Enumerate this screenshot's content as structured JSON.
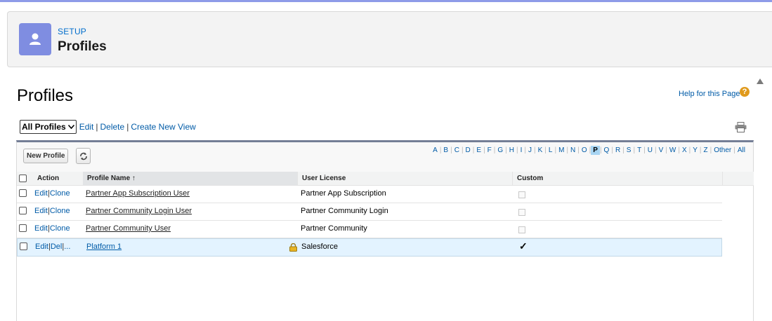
{
  "header": {
    "section_label": "SETUP",
    "title": "Profiles",
    "icon": "user-icon"
  },
  "page": {
    "title": "Profiles",
    "help_link": "Help for this Page",
    "help_icon": "question-icon"
  },
  "view_controls": {
    "selected_view": "All Profiles",
    "edit": "Edit",
    "delete": "Delete",
    "create_new_view": "Create New View",
    "sep": "|"
  },
  "list": {
    "new_profile_button": "New Profile",
    "alphabet": [
      "A",
      "B",
      "C",
      "D",
      "E",
      "F",
      "G",
      "H",
      "I",
      "J",
      "K",
      "L",
      "M",
      "N",
      "O",
      "P",
      "Q",
      "R",
      "S",
      "T",
      "U",
      "V",
      "W",
      "X",
      "Y",
      "Z",
      "Other",
      "All"
    ],
    "active_letter": "P",
    "columns": {
      "action": "Action",
      "profile_name": "Profile Name",
      "sort_indicator": "↑",
      "user_license": "User License",
      "custom": "Custom"
    },
    "rows": [
      {
        "actions": [
          "Edit",
          "Clone"
        ],
        "name": "Partner App Subscription User",
        "license": "Partner App Subscription",
        "custom": false
      },
      {
        "actions": [
          "Edit",
          "Clone"
        ],
        "name": "Partner Community Login User",
        "license": "Partner Community Login",
        "custom": false
      },
      {
        "actions": [
          "Edit",
          "Clone"
        ],
        "name": "Partner Community User",
        "license": "Partner Community",
        "custom": false
      },
      {
        "actions": [
          "Edit",
          "Del",
          "..."
        ],
        "name": "Platform 1",
        "license": "Salesforce",
        "custom": true,
        "locked": true,
        "highlighted": true
      }
    ]
  },
  "colors": {
    "accent": "#015ba7",
    "setup_icon_bg": "#7f8de1",
    "highlight_row": "#e3f3ff"
  }
}
